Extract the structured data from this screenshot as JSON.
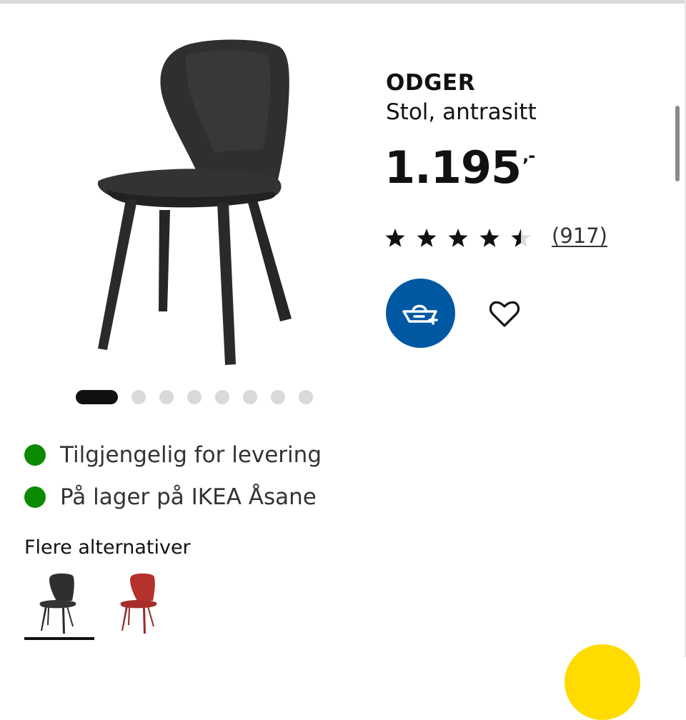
{
  "product": {
    "name": "ODGER",
    "description": "Stol, antrasitt",
    "price": "1.195",
    "price_suffix": ",-",
    "rating_value": 4.5,
    "rating_max": 5,
    "review_count": "(917)"
  },
  "gallery": {
    "image_count": 8,
    "active_index": 0
  },
  "availability": {
    "delivery": "Tilgjengelig for levering",
    "store": "På lager på IKEA Åsane"
  },
  "alternatives": {
    "title": "Flere alternativer",
    "options": [
      {
        "color_name": "antrasitt",
        "color": "#2b2b2b",
        "selected": true
      },
      {
        "color_name": "rød",
        "color": "#b4312d",
        "selected": false
      }
    ]
  },
  "colors": {
    "brand_blue": "#0058a3",
    "stock_green": "#0a8a00",
    "accent_yellow": "#ffdb00",
    "text": "#111111"
  },
  "icons": {
    "add_to_cart": "shopping-basket-plus-icon",
    "favourite": "heart-icon",
    "rating": "star-icon"
  }
}
